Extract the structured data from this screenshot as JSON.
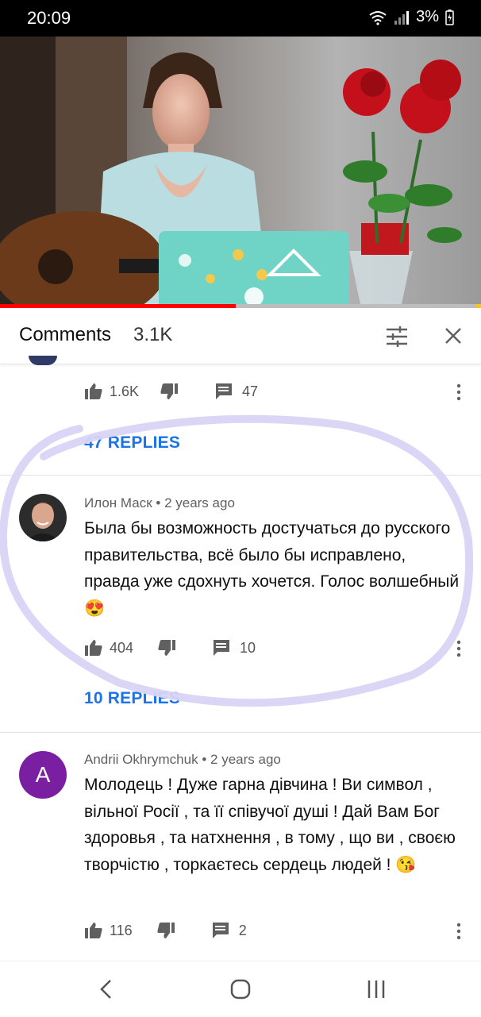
{
  "status": {
    "time": "20:09",
    "battery": "3%"
  },
  "player": {
    "progress_fraction": 0.49
  },
  "comments_header": {
    "title": "Comments",
    "count": "3.1K"
  },
  "comments": [
    {
      "likes": "1.6K",
      "replies_count": "47",
      "replies_label": "47 REPLIES"
    },
    {
      "author": "Илон Маск",
      "time": "2 years ago",
      "text": "Была бы возможность достучаться до русского правительства, всё было бы исправлено, правда уже сдохнуть хочется. Голос волшебный😍",
      "likes": "404",
      "replies_count": "10",
      "replies_label": "10 REPLIES"
    },
    {
      "author": "Andrii Okhrymchuk",
      "avatar_letter": "A",
      "avatar_color": "#7b1fa2",
      "time": "2 years ago",
      "text": "Молодець ! Дуже гарна дівчина ! Ви символ , вільної Росії , та її співучої душі ! Дай Вам Бог здоровья , та натхнення , в тому , що ви , своєю творчістю , торкаєтесь сердець людей ! 😘",
      "likes": "116",
      "replies_count": "2"
    }
  ],
  "colors": {
    "accent": "#1a73e8",
    "progress": "#ff0000",
    "annotation": "#d9d4f5"
  }
}
